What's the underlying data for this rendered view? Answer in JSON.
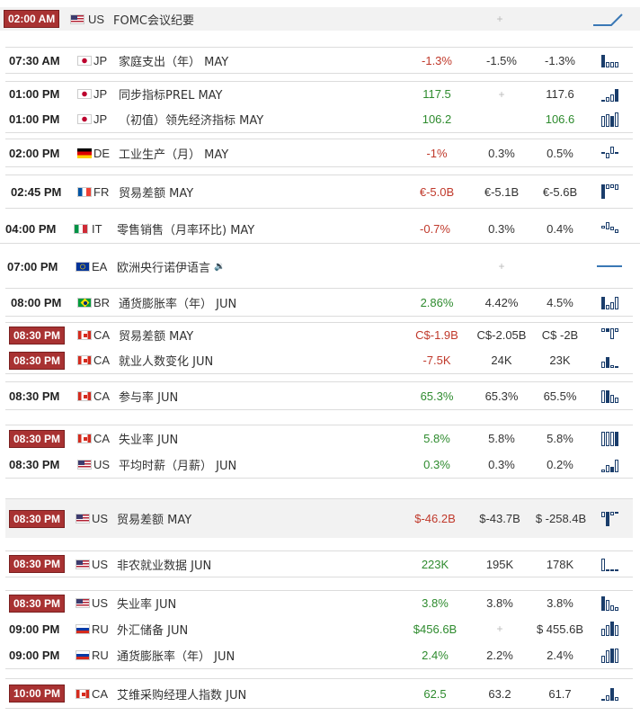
{
  "rows": [
    {
      "time": "02:00 AM",
      "badge": true,
      "country": "US",
      "event": "FOMC会议纪要",
      "actual": "",
      "forecast": "+",
      "previous": "",
      "spark": "line"
    },
    {
      "time": "07:30 AM",
      "badge": false,
      "country": "JP",
      "event": "家庭支出（年） MAY",
      "actual": "-1.3%",
      "forecast": "-1.5%",
      "previous": "-1.3%"
    },
    {
      "time": "01:00 PM",
      "badge": false,
      "country": "JP",
      "event": "同步指标PREL MAY",
      "actual": "117.5",
      "forecast": "+",
      "previous": "117.6"
    },
    {
      "time": "01:00 PM",
      "badge": false,
      "country": "JP",
      "event": "（初值）领先经济指标 MAY",
      "actual": "106.2",
      "forecast": "",
      "previous": "106.6"
    },
    {
      "time": "02:00 PM",
      "badge": false,
      "country": "DE",
      "event": "工业生产（月） MAY",
      "actual": "-1%",
      "forecast": "0.3%",
      "previous": "0.5%"
    },
    {
      "time": "02:45 PM",
      "badge": false,
      "country": "FR",
      "event": "贸易差额 MAY",
      "actual": "€-5.0B",
      "forecast": "€-5.1B",
      "previous": "€-5.6B"
    },
    {
      "time": "04:00 PM",
      "badge": false,
      "country": "IT",
      "event": "零售销售（月率环比) MAY",
      "actual": "-0.7%",
      "forecast": "0.3%",
      "previous": "0.4%"
    },
    {
      "time": "07:00 PM",
      "badge": false,
      "country": "EA",
      "event": "欧洲央行诺伊语言",
      "actual": "",
      "forecast": "+",
      "previous": "",
      "spark": "flat"
    },
    {
      "time": "08:00 PM",
      "badge": false,
      "country": "BR",
      "event": "通货膨胀率（年） JUN",
      "actual": "2.86%",
      "forecast": "4.42%",
      "previous": "4.5%"
    },
    {
      "time": "08:30 PM",
      "badge": true,
      "country": "CA",
      "event": "贸易差额 MAY",
      "actual": "C$-1.9B",
      "forecast": "C$-2.05B",
      "previous": "C$ -2B"
    },
    {
      "time": "08:30 PM",
      "badge": true,
      "country": "CA",
      "event": "就业人数变化 JUN",
      "actual": "-7.5K",
      "forecast": "24K",
      "previous": "23K"
    },
    {
      "time": "08:30 PM",
      "badge": false,
      "country": "CA",
      "event": "参与率 JUN",
      "actual": "65.3%",
      "forecast": "65.3%",
      "previous": "65.5%"
    },
    {
      "time": "08:30 PM",
      "badge": true,
      "country": "CA",
      "event": "失业率 JUN",
      "actual": "5.8%",
      "forecast": "5.8%",
      "previous": "5.8%"
    },
    {
      "time": "08:30 PM",
      "badge": false,
      "country": "US",
      "event": "平均时薪（月薪） JUN",
      "actual": "0.3%",
      "forecast": "0.3%",
      "previous": "0.2%"
    },
    {
      "time": "08:30 PM",
      "badge": true,
      "country": "US",
      "event": "贸易差额 MAY",
      "actual": "$-46.2B",
      "forecast": "$-43.7B",
      "previous": "$ -258.4B"
    },
    {
      "time": "08:30 PM",
      "badge": true,
      "country": "US",
      "event": "非农就业数据 JUN",
      "actual": "223K",
      "forecast": "195K",
      "previous": "178K"
    },
    {
      "time": "08:30 PM",
      "badge": true,
      "country": "US",
      "event": "失业率 JUN",
      "actual": "3.8%",
      "forecast": "3.8%",
      "previous": "3.8%"
    },
    {
      "time": "09:00 PM",
      "badge": false,
      "country": "RU",
      "event": "外汇储备 JUN",
      "actual": "$456.6B",
      "forecast": "+",
      "previous": "$ 455.6B"
    },
    {
      "time": "09:00 PM",
      "badge": false,
      "country": "RU",
      "event": "通货膨胀率（年） JUN",
      "actual": "2.4%",
      "forecast": "2.2%",
      "previous": "2.4%"
    },
    {
      "time": "10:00 PM",
      "badge": true,
      "country": "CA",
      "event": "艾维采购经理人指数 JUN",
      "actual": "62.5",
      "forecast": "63.2",
      "previous": "61.7"
    }
  ],
  "colors": {
    "negative": "#c0392b",
    "positive": "#2e8b2e",
    "badge": "#a83232",
    "spark": "#1a3d6b"
  }
}
